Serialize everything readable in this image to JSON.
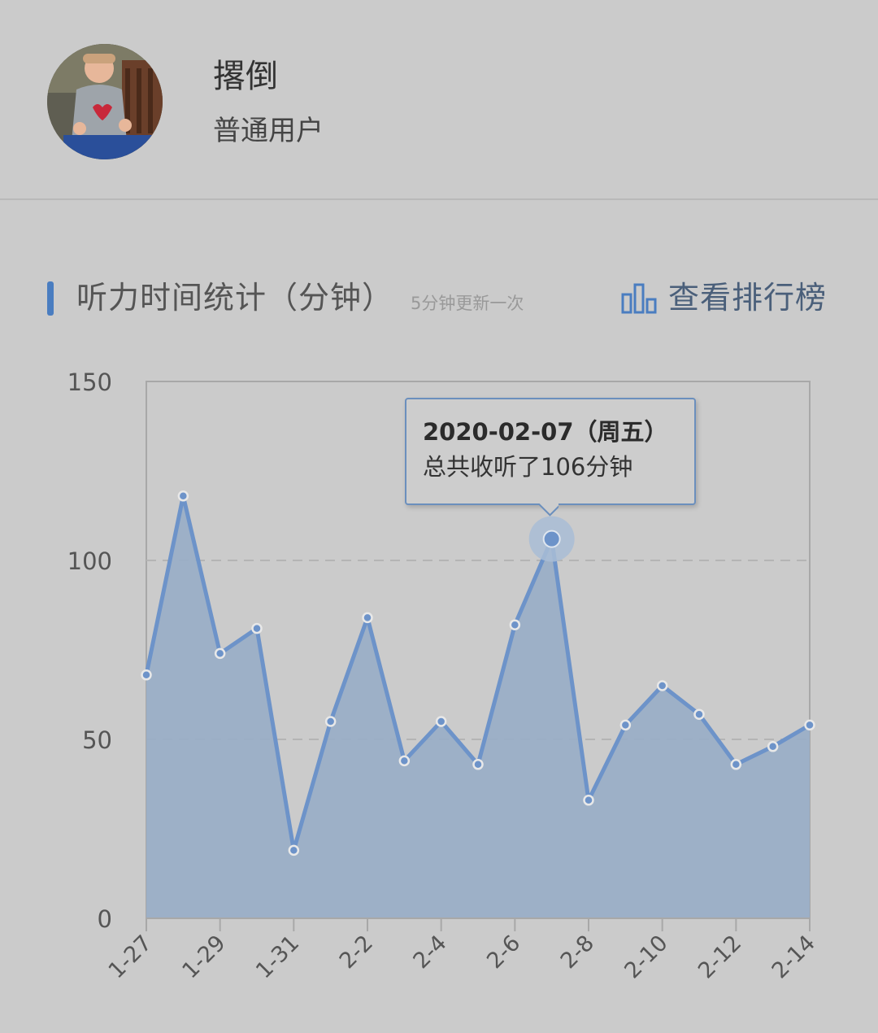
{
  "profile": {
    "name": "撂倒",
    "role": "普通用户"
  },
  "stats": {
    "title": "听力时间统计（分钟）",
    "note": "5分钟更新一次",
    "rank_link": "查看排行榜"
  },
  "tooltip": {
    "date": "2020-02-07（周五）",
    "text": "总共收听了106分钟"
  },
  "colors": {
    "accent": "#4a7dc0",
    "line": "#6d93c9",
    "area": "#9aaec6"
  },
  "chart_data": {
    "type": "area",
    "x": [
      "1-27",
      "1-28",
      "1-29",
      "1-30",
      "1-31",
      "2-1",
      "2-2",
      "2-3",
      "2-4",
      "2-5",
      "2-6",
      "2-7",
      "2-8",
      "2-9",
      "2-10",
      "2-11",
      "2-12",
      "2-13",
      "2-14"
    ],
    "tick_labels": [
      "1-27",
      "1-29",
      "1-31",
      "2-2",
      "2-4",
      "2-6",
      "2-8",
      "2-10",
      "2-12",
      "2-14"
    ],
    "values": [
      68,
      118,
      74,
      81,
      19,
      55,
      84,
      44,
      55,
      43,
      82,
      106,
      33,
      54,
      65,
      57,
      43,
      48,
      54
    ],
    "highlight_index": 11,
    "ylim": [
      0,
      150
    ],
    "yticks": [
      0,
      50,
      100,
      150
    ],
    "grid": true
  }
}
